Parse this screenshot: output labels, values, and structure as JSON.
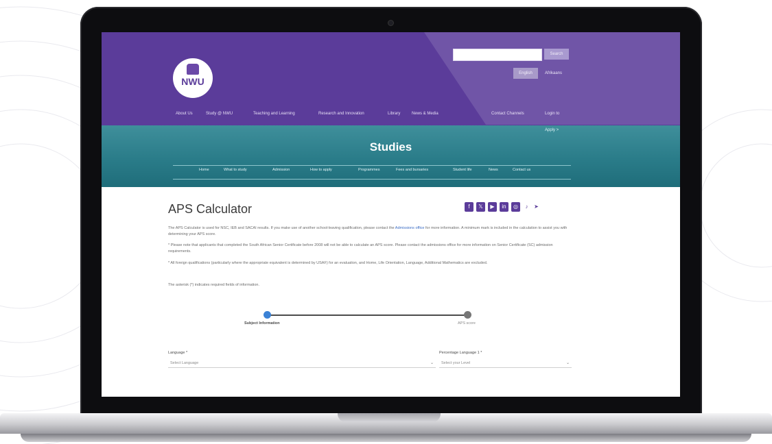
{
  "header": {
    "logo_text": "NWU",
    "search_button": "Search",
    "language_button": "English",
    "language_link": "Afrikaans",
    "nav_items": [
      "About Us",
      "Study @ NWU",
      "Teaching and Learning",
      "Research and Innovation",
      "Library",
      "News & Media",
      "Contact Channels",
      "Login to"
    ]
  },
  "banner": {
    "title": "Studies",
    "right_link": "Apply >",
    "subnav_items": [
      "Home",
      "What to study",
      "Admission",
      "How to apply",
      "Programmes",
      "Fees and bursaries",
      "Student life",
      "News",
      "Contact us"
    ]
  },
  "main": {
    "title": "APS Calculator",
    "social_icons": [
      "facebook-icon",
      "x-icon",
      "youtube-icon",
      "linkedin-icon",
      "instagram-icon",
      "tiktok-icon",
      "telegram-icon"
    ],
    "social_glyphs": [
      "f",
      "𝕏",
      "▶",
      "in",
      "◎",
      "♪",
      "➤"
    ],
    "para1": "The APS Calculator is used for NSC, IEB and SACAI results. If you make use of another school-leaving qualification, please contact the",
    "para1_link": "Admissions office",
    "para1_end": "for more information. A minimum mark is included in the calculation to assist you with determining your APS score.",
    "para2": "* Please note that applicants that completed the South African Senior Certificate before 2008 will not be able to calculate an APS score. Please contact the admissions office for more information on Senior Certificate (SC) admission requirements.",
    "para3": "* All foreign qualifications (particularly where the appropriate equivalent is determined by USAF) for an evaluation, and Home, Life Orientation, Language, Additional Mathematics are excluded.",
    "required_note": "The asterisk (*) indicates required fields of information.",
    "steps": [
      "Subject Information",
      "APS score"
    ],
    "fields": [
      {
        "label": "Language *",
        "placeholder": "Select Language"
      },
      {
        "label": "Percentage Language 1 *",
        "placeholder": "Select your Level"
      }
    ]
  }
}
